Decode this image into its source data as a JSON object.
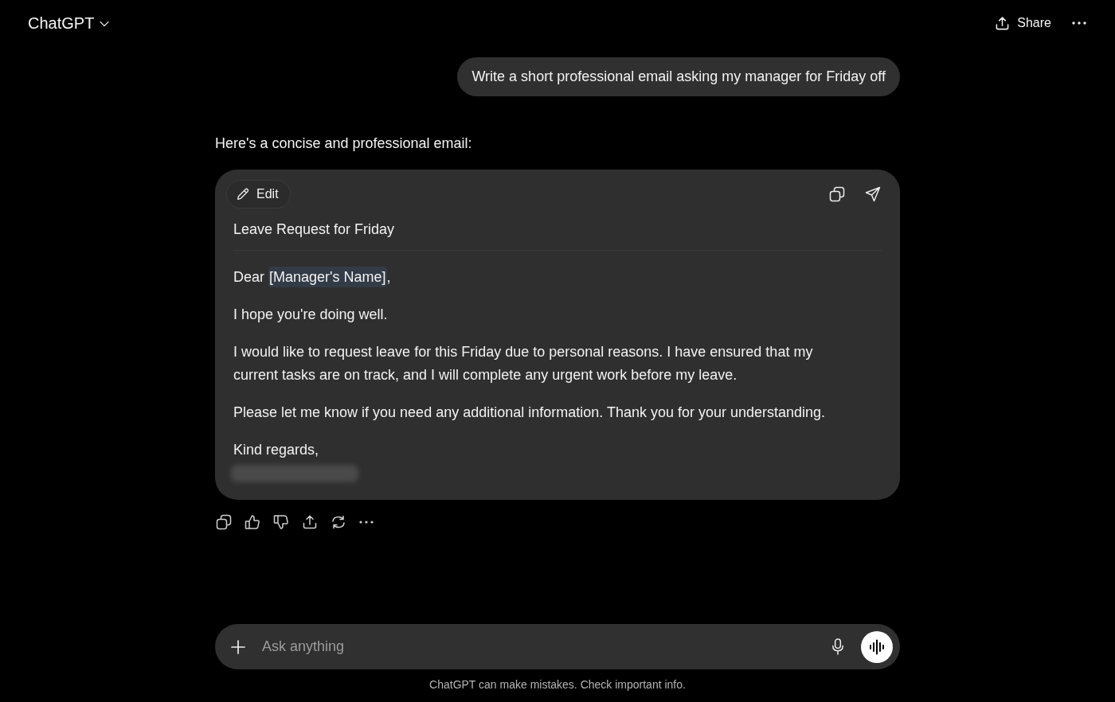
{
  "header": {
    "title": "ChatGPT",
    "share_label": "Share"
  },
  "conversation": {
    "user_message": "Write a short professional email asking my manager for Friday off",
    "assistant_intro": "Here's a concise and professional email:",
    "canvas": {
      "edit_label": "Edit",
      "subject": "Leave Request for Friday",
      "paragraphs": [
        {
          "segments": [
            {
              "text": "Dear ",
              "highlighted": false
            },
            {
              "text": "[Manager's Name]",
              "highlighted": true
            },
            {
              "text": ",",
              "highlighted": false
            }
          ]
        },
        {
          "segments": [
            {
              "text": "I hope you're doing well.",
              "highlighted": false
            }
          ]
        },
        {
          "segments": [
            {
              "text": "I would like to request leave for this Friday due to personal reasons. I have ensured that my current tasks are on track, and I will complete any urgent work before my leave.",
              "highlighted": false
            }
          ]
        },
        {
          "segments": [
            {
              "text": "Please let me know if you need any additional information. Thank you for your understanding.",
              "highlighted": false
            }
          ]
        },
        {
          "segments": [
            {
              "text": "Kind regards,",
              "highlighted": false
            }
          ]
        }
      ],
      "signature_blurred": true
    }
  },
  "composer": {
    "placeholder": "Ask anything"
  },
  "footer": "ChatGPT can make mistakes. Check important info."
}
